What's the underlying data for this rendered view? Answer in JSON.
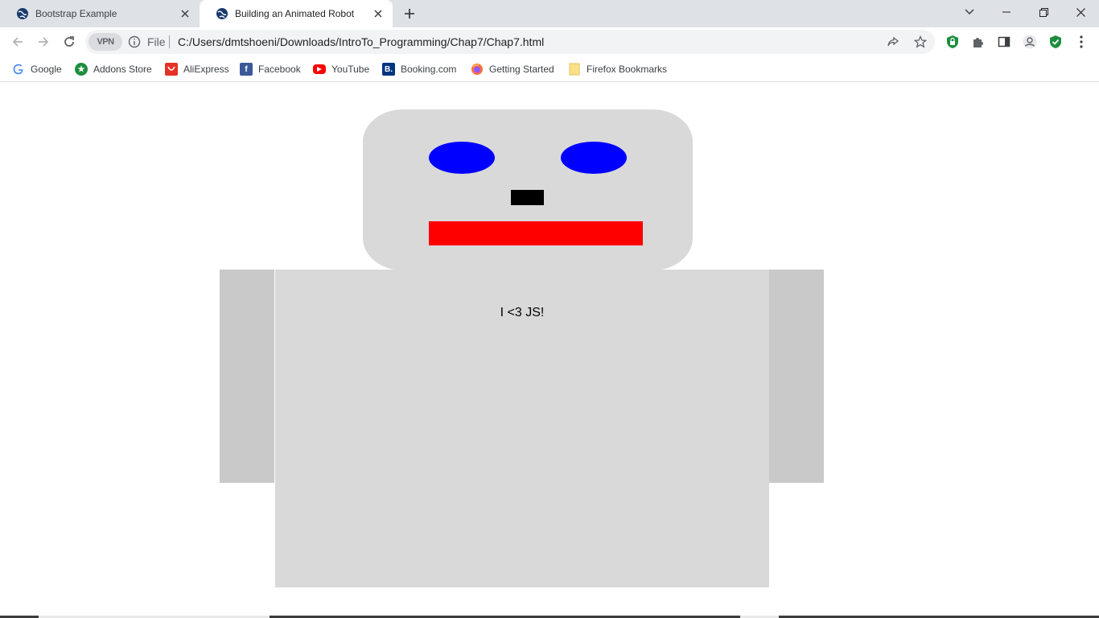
{
  "browser": {
    "tabs": [
      {
        "title": "Bootstrap Example",
        "active": false
      },
      {
        "title": "Building an Animated Robot",
        "active": true
      }
    ],
    "address": {
      "vpn_label": "VPN",
      "scheme_label": "File",
      "url": "C:/Users/dmtshoeni/Downloads/IntroTo_Programming/Chap7/Chap7.html"
    },
    "bookmarks": [
      {
        "label": "Google",
        "icon": "google-icon"
      },
      {
        "label": "Addons Store",
        "icon": "addons-store-icon"
      },
      {
        "label": "AliExpress",
        "icon": "aliexpress-icon"
      },
      {
        "label": "Facebook",
        "icon": "facebook-icon"
      },
      {
        "label": "YouTube",
        "icon": "youtube-icon"
      },
      {
        "label": "Booking.com",
        "icon": "booking-icon"
      },
      {
        "label": "Getting Started",
        "icon": "firefox-icon"
      },
      {
        "label": "Firefox Bookmarks",
        "icon": "folder-icon"
      }
    ]
  },
  "robot": {
    "body_text": "I <3 JS!",
    "colors": {
      "head": "#d9d9d9",
      "eyes": "#0000ff",
      "nose": "#000000",
      "mouth": "#ff0000",
      "arms": "#c9c9c9",
      "body": "#d9d9d9"
    }
  }
}
